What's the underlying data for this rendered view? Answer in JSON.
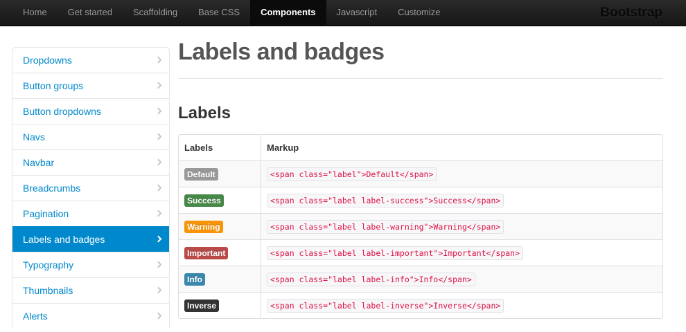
{
  "navbar": {
    "links": [
      {
        "label": "Home"
      },
      {
        "label": "Get started"
      },
      {
        "label": "Scaffolding"
      },
      {
        "label": "Base CSS"
      },
      {
        "label": "Components",
        "active": true
      },
      {
        "label": "Javascript"
      },
      {
        "label": "Customize"
      }
    ],
    "brand": "Bootstrap"
  },
  "sidebar": {
    "items": [
      {
        "label": "Dropdowns"
      },
      {
        "label": "Button groups"
      },
      {
        "label": "Button dropdowns"
      },
      {
        "label": "Navs"
      },
      {
        "label": "Navbar"
      },
      {
        "label": "Breadcrumbs"
      },
      {
        "label": "Pagination"
      },
      {
        "label": "Labels and badges",
        "active": true
      },
      {
        "label": "Typography"
      },
      {
        "label": "Thumbnails"
      },
      {
        "label": "Alerts"
      }
    ]
  },
  "main": {
    "page_title": "Labels and badges",
    "section_title": "Labels",
    "table": {
      "headers": [
        "Labels",
        "Markup"
      ],
      "rows": [
        {
          "label": "Default",
          "color": "#999999",
          "markup": "<span class=\"label\">Default</span>"
        },
        {
          "label": "Success",
          "color": "#468847",
          "markup": "<span class=\"label label-success\">Success</span>"
        },
        {
          "label": "Warning",
          "color": "#f89406",
          "markup": "<span class=\"label label-warning\">Warning</span>"
        },
        {
          "label": "Important",
          "color": "#b94a48",
          "markup": "<span class=\"label label-important\">Important</span>"
        },
        {
          "label": "Info",
          "color": "#3a87ad",
          "markup": "<span class=\"label label-info\">Info</span>"
        },
        {
          "label": "Inverse",
          "color": "#333333",
          "markup": "<span class=\"label label-inverse\">Inverse</span>"
        }
      ]
    }
  },
  "colors": {
    "link": "#0088cc",
    "code_text": "#dd1144"
  }
}
